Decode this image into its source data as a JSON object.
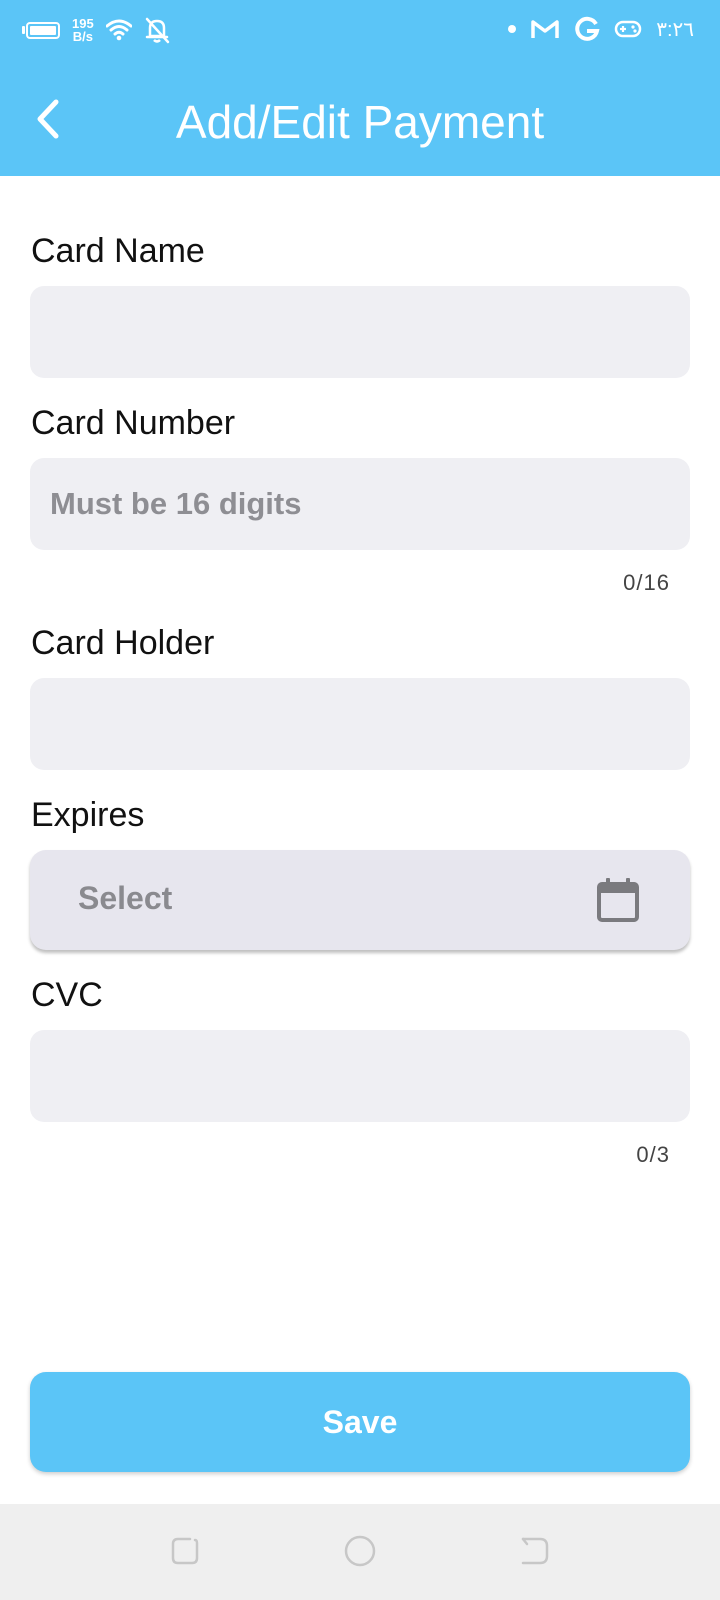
{
  "status_bar": {
    "net_speed_value": "195",
    "net_speed_unit": "B/s",
    "time": "٣:٢٦",
    "icons": [
      "battery-icon",
      "wifi-icon",
      "bell-off-icon",
      "dot-icon",
      "gmail-icon",
      "google-icon",
      "gamepad-icon"
    ]
  },
  "app_bar": {
    "title": "Add/Edit Payment",
    "back_icon": "back-arrow-icon"
  },
  "form": {
    "card_name": {
      "label": "Card Name",
      "value": "",
      "placeholder": ""
    },
    "card_number": {
      "label": "Card Number",
      "value": "",
      "placeholder": "Must be 16 digits",
      "counter": "0/16"
    },
    "card_holder": {
      "label": "Card Holder",
      "value": "",
      "placeholder": ""
    },
    "expires": {
      "label": "Expires",
      "select_text": "Select",
      "icon": "calendar-icon"
    },
    "cvc": {
      "label": "CVC",
      "value": "",
      "placeholder": "",
      "counter": "0/3"
    }
  },
  "save_button": {
    "label": "Save"
  },
  "colors": {
    "primary": "#5bc5f7",
    "field_background": "#efeff3",
    "select_background": "#e7e6ee",
    "placeholder": "#8e8e93",
    "nav_bar": "#efefef"
  },
  "nav_bar": {
    "icons": [
      "recents-icon",
      "home-icon",
      "back-icon"
    ]
  }
}
